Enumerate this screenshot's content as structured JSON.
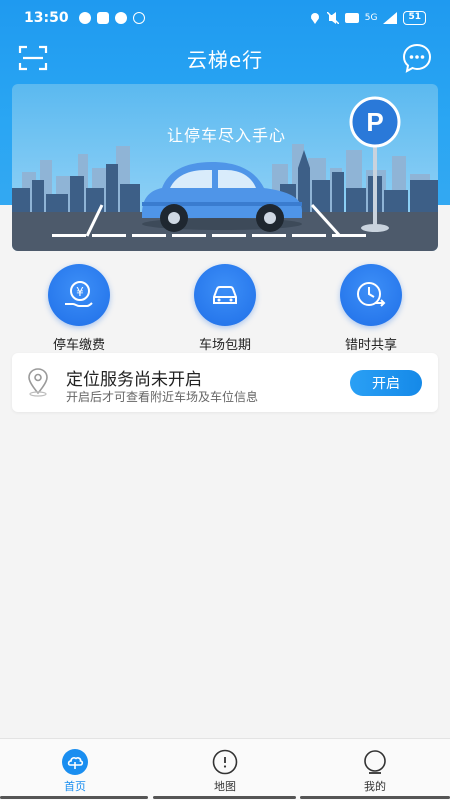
{
  "status": {
    "time": "13:50",
    "network": "5G",
    "battery": "51"
  },
  "header": {
    "title": "云梯e行"
  },
  "banner": {
    "slogan": "让停车尽入手心",
    "sign_letter": "P"
  },
  "features": [
    {
      "label": "停车缴费",
      "icon": "yen-hand-icon"
    },
    {
      "label": "车场包期",
      "icon": "car-icon"
    },
    {
      "label": "错时共享",
      "icon": "clock-share-icon"
    }
  ],
  "location": {
    "title": "定位服务尚未开启",
    "subtitle": "开启后才可查看附近车场及车位信息",
    "button_label": "开启"
  },
  "nav": [
    {
      "label": "首页",
      "active": true
    },
    {
      "label": "地图",
      "active": false
    },
    {
      "label": "我的",
      "active": false
    }
  ],
  "colors": {
    "primary": "#1a8ef0",
    "feature_blue": "#1f6fe8"
  }
}
